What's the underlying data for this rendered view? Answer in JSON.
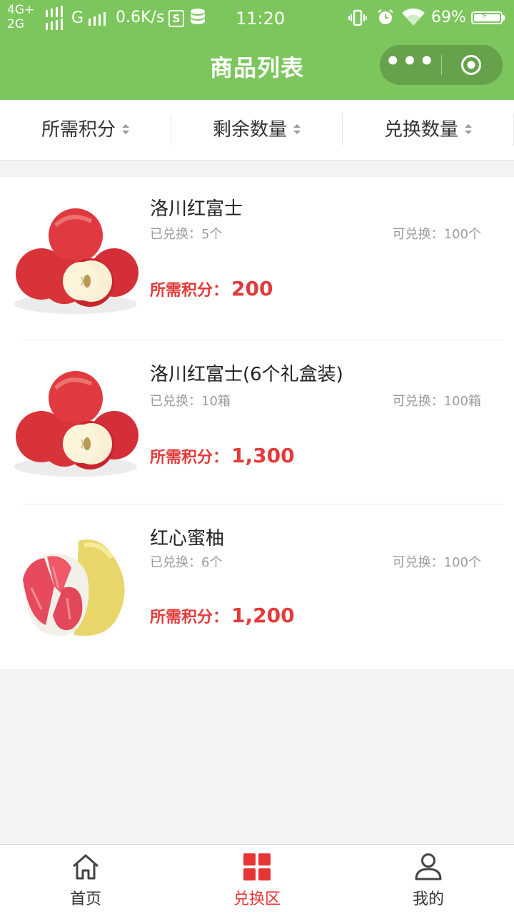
{
  "status_bar": {
    "network_top": "4G+",
    "network_bottom": "2G",
    "signal_g": "G",
    "speed": "0.6K/s",
    "s_icon_letter": "S",
    "time": "11:20",
    "battery_percent": "69%",
    "battery_level": 0.69
  },
  "header": {
    "title": "商品列表",
    "capsule_more_icon": "more-dots-icon",
    "capsule_close_icon": "target-close-icon",
    "bg_color": "#7dc65d"
  },
  "filters": [
    {
      "label": "所需积分",
      "icon": "sort-arrows-icon"
    },
    {
      "label": "剩余数量",
      "icon": "sort-arrows-icon"
    },
    {
      "label": "兑换数量",
      "icon": "sort-arrows-icon"
    }
  ],
  "products": [
    {
      "name": "洛川红富士",
      "exchanged": "已兑换：5个",
      "available": "可兑换：100个",
      "points_label": "所需积分：",
      "points": "200",
      "image": "apples-image"
    },
    {
      "name": "洛川红富士(6个礼盒装)",
      "exchanged": "已兑换：10箱",
      "available": "可兑换：100箱",
      "points_label": "所需积分：",
      "points": "1,300",
      "image": "apples-image"
    },
    {
      "name": "红心蜜柚",
      "exchanged": "已兑换：6个",
      "available": "可兑换：100个",
      "points_label": "所需积分：",
      "points": "1,200",
      "image": "pomelo-image"
    }
  ],
  "tabbar": [
    {
      "label": "首页",
      "icon": "home-icon",
      "active": false
    },
    {
      "label": "兑换区",
      "icon": "grid-icon",
      "active": true
    },
    {
      "label": "我的",
      "icon": "user-icon",
      "active": false
    }
  ],
  "colors": {
    "accent_red": "#e33b3b",
    "header_green": "#7dc65d"
  }
}
